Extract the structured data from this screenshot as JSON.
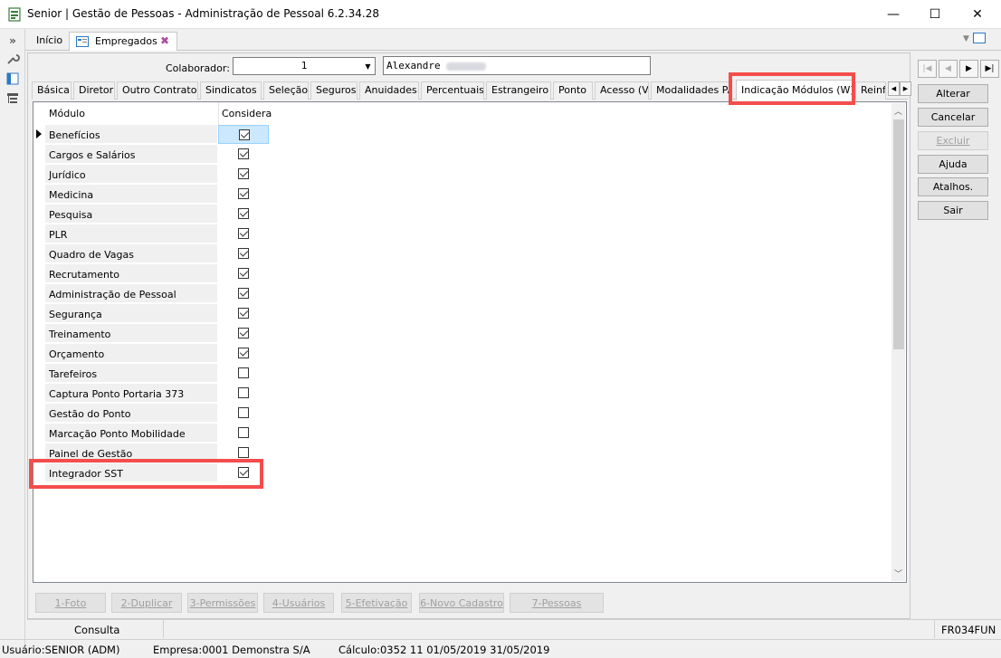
{
  "window": {
    "title": "Senior | Gestão de Pessoas - Administração de Pessoal 6.2.34.28",
    "minimize": "—",
    "maximize": "☐",
    "close": "✕"
  },
  "left_strip": {
    "collapse": "»"
  },
  "doc_tabs": [
    {
      "label": "Início"
    },
    {
      "label": "Empregados"
    }
  ],
  "colaborador": {
    "label": "Colaborador:",
    "value": "1",
    "name": "Alexandre"
  },
  "section_tabs": [
    "Básica",
    "Diretor",
    "Outro Contrato",
    "Sindicatos",
    "Seleção",
    "Seguros",
    "Anuidades",
    "Percentuais",
    "Estrangeiro",
    "Ponto",
    "Acesso (V)",
    "Modalidades PAT",
    "Indicação Módulos (W)",
    "Reinf"
  ],
  "grid": {
    "col_modulo": "Módulo",
    "col_considera": "Considera",
    "rows": [
      {
        "name": "Benefícios",
        "checked": true
      },
      {
        "name": "Cargos e Salários",
        "checked": true
      },
      {
        "name": "Jurídico",
        "checked": true
      },
      {
        "name": "Medicina",
        "checked": true
      },
      {
        "name": "Pesquisa",
        "checked": true
      },
      {
        "name": "PLR",
        "checked": true
      },
      {
        "name": "Quadro de Vagas",
        "checked": true
      },
      {
        "name": "Recrutamento",
        "checked": true
      },
      {
        "name": "Administração de Pessoal",
        "checked": true
      },
      {
        "name": "Segurança",
        "checked": true
      },
      {
        "name": "Treinamento",
        "checked": true
      },
      {
        "name": "Orçamento",
        "checked": true
      },
      {
        "name": "Tarefeiros",
        "checked": false
      },
      {
        "name": "Captura Ponto Portaria 373",
        "checked": false
      },
      {
        "name": "Gestão do Ponto",
        "checked": false
      },
      {
        "name": "Marcação Ponto Mobilidade",
        "checked": false
      },
      {
        "name": "Painel de Gestão",
        "checked": false
      },
      {
        "name": "Integrador SST",
        "checked": true
      }
    ]
  },
  "bottom_buttons": [
    "1-Foto",
    "2-Duplicar",
    "3-Permissões",
    "4-Usuários",
    "5-Efetivação",
    "6-Novo Cadastro",
    "7-Pessoas"
  ],
  "right_panel": {
    "nav": [
      "|◀",
      "◀",
      "▶",
      "▶|"
    ],
    "actions": [
      {
        "label": "Alterar",
        "enabled": true
      },
      {
        "label": "Cancelar",
        "enabled": true
      },
      {
        "label": "Excluir",
        "enabled": false
      },
      {
        "label": "Ajuda",
        "enabled": true
      },
      {
        "label": "Atalhos.",
        "enabled": true
      },
      {
        "label": "Sair",
        "enabled": true
      }
    ]
  },
  "status": {
    "mode": "Consulta",
    "form_code": "FR034FUN",
    "usuario": "Usuário:SENIOR (ADM)",
    "empresa": "Empresa:0001  Demonstra S/A",
    "calculo": "Cálculo:0352  11  01/05/2019  31/05/2019"
  },
  "highlight_color": "#f44d4d"
}
